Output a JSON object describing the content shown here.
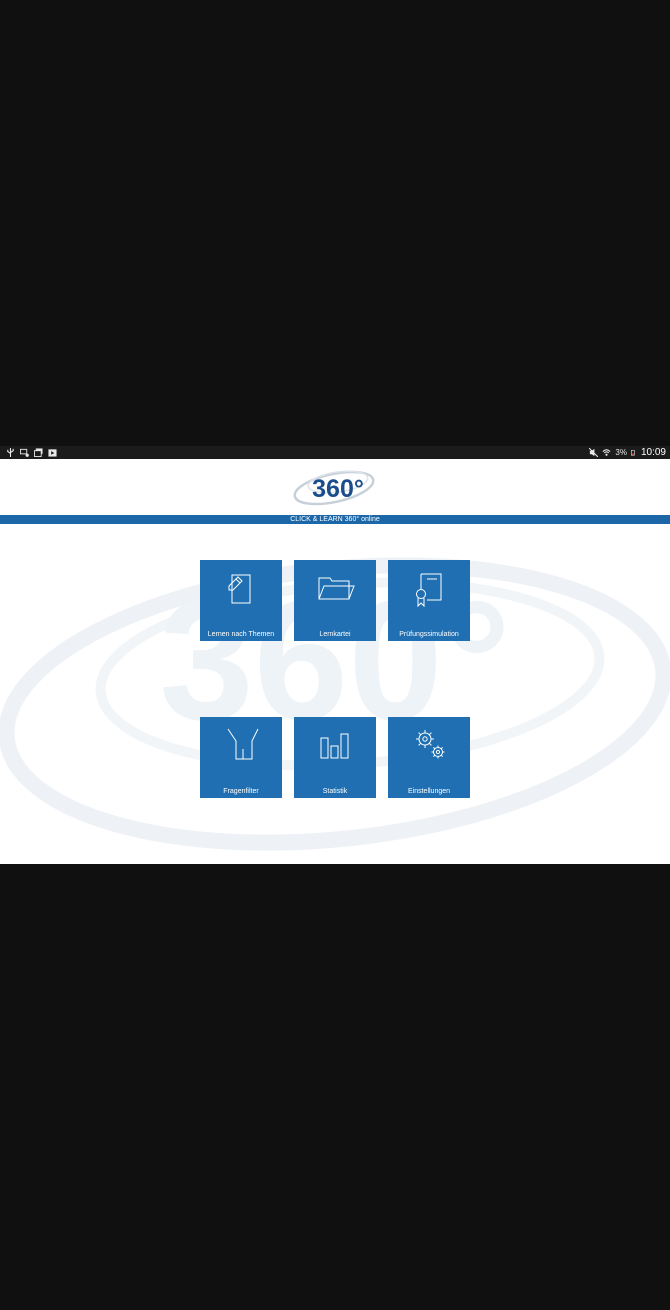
{
  "status_bar": {
    "left_icons": [
      "usb-icon",
      "screen-cast-icon",
      "gallery-icon",
      "play-store-icon"
    ],
    "right_icons": [
      "mute-icon",
      "wifi-icon",
      "battery-icon"
    ],
    "battery_percent": "3%",
    "time": "10:09"
  },
  "header": {
    "logo_text": "360°",
    "banner_text": "CLICK & LEARN 360° online"
  },
  "watermark": {
    "text": "360°"
  },
  "tiles": [
    {
      "label": "Lernen nach Themen",
      "icon": "document-pen-icon"
    },
    {
      "label": "Lernkartei",
      "icon": "folder-icon"
    },
    {
      "label": "Prüfungssimulation",
      "icon": "certificate-icon"
    },
    {
      "label": "Fragenfilter",
      "icon": "filter-icon"
    },
    {
      "label": "Statistik",
      "icon": "bar-chart-icon"
    },
    {
      "label": "Einstellungen",
      "icon": "gears-icon"
    }
  ],
  "colors": {
    "tile": "#1f6fb2",
    "banner": "#1b67a8",
    "logo": "#1b4d8c",
    "background": "#101010"
  }
}
